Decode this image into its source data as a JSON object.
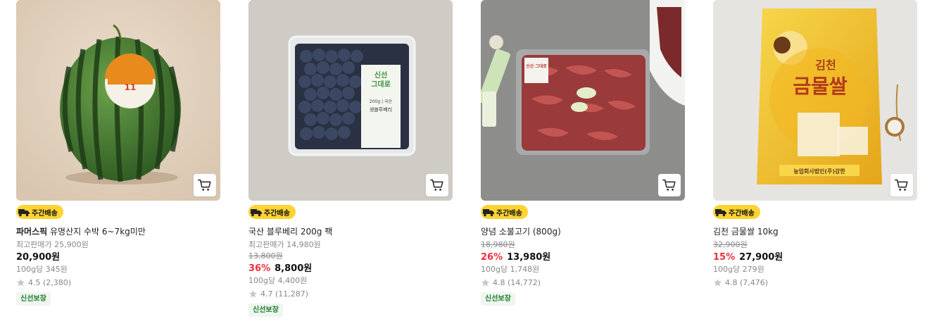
{
  "products": [
    {
      "badge": "주간배송",
      "brand": "파머스픽",
      "name": "유명산지 수박 6~7kg미만",
      "max_price": "최고판매가 25,900원",
      "original_price": "",
      "discount": "",
      "price": "20,900원",
      "unit_price": "100g당 345원",
      "rating": "4.5 (2,380)",
      "tag": "신선보장"
    },
    {
      "badge": "주간배송",
      "brand": "",
      "name": "국산 블루베리 200g 팩",
      "max_price": "최고판매가 14,980원",
      "original_price": "13,800원",
      "discount": "36%",
      "price": "8,800원",
      "unit_price": "100g당 4,400원",
      "rating": "4.7 (11,287)",
      "tag": "신선보장"
    },
    {
      "badge": "주간배송",
      "brand": "",
      "name": "양념 소불고기 (800g)",
      "max_price": "",
      "original_price": "18,980원",
      "discount": "26%",
      "price": "13,980원",
      "unit_price": "100g당 1,748원",
      "rating": "4.8 (14,772)",
      "tag": "신선보장"
    },
    {
      "badge": "주간배송",
      "brand": "",
      "name": "김천 금물쌀 10kg",
      "max_price": "",
      "original_price": "32,900원",
      "discount": "15%",
      "price": "27,900원",
      "unit_price": "100g당 279원",
      "rating": "4.8 (7,476)",
      "tag": ""
    }
  ],
  "image_text": {
    "watermelon_sticker_number": "11",
    "blueberry_label_line1": "신선",
    "blueberry_label_line2": "그대로",
    "blueberry_label_name": "생블루베리",
    "blueberry_label_weight": "200g | 국산",
    "beef_label": "신선 그대로",
    "rice_brand_small": "김천",
    "rice_brand_large": "금물쌀",
    "rice_maker": "농업회사법인(주)강한"
  },
  "colors": {
    "badge_yellow": "#ffd333",
    "discount_red": "#ef2e3c",
    "fresh_green": "#1d7a2b"
  },
  "icons": {
    "cart": "cart-icon",
    "delivery": "truck-icon",
    "rating": "star-icon"
  }
}
